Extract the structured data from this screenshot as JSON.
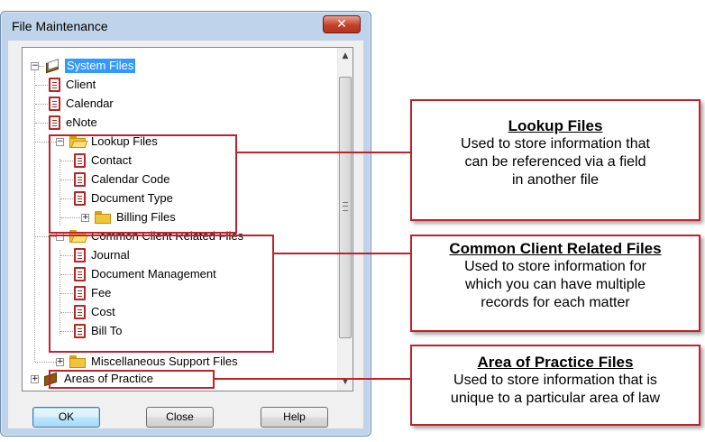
{
  "window": {
    "title": "File Maintenance",
    "close_glyph": "✕"
  },
  "tree": {
    "items": [
      {
        "label": "System Files",
        "icon": "book-icon",
        "selected": true
      },
      {
        "label": "Client",
        "icon": "document-icon"
      },
      {
        "label": "Calendar",
        "icon": "document-icon"
      },
      {
        "label": "eNote",
        "icon": "document-icon"
      },
      {
        "label": "Lookup Files",
        "icon": "open-folder-icon"
      },
      {
        "label": "Contact",
        "icon": "document-icon"
      },
      {
        "label": "Calendar Code",
        "icon": "document-icon"
      },
      {
        "label": "Document Type",
        "icon": "document-icon"
      },
      {
        "label": "Billing Files",
        "icon": "folder-icon"
      },
      {
        "label": "Common Client Related Files",
        "icon": "open-folder-icon"
      },
      {
        "label": "Journal",
        "icon": "document-icon"
      },
      {
        "label": "Document Management",
        "icon": "document-icon"
      },
      {
        "label": "Fee",
        "icon": "document-icon"
      },
      {
        "label": "Cost",
        "icon": "document-icon"
      },
      {
        "label": "Bill To",
        "icon": "document-icon"
      },
      {
        "label": "Miscellaneous Support Files",
        "icon": "folder-icon"
      },
      {
        "label": "Areas of Practice",
        "icon": "book-icon"
      }
    ],
    "expand_glyphs": {
      "collapse": "−",
      "expand": "+"
    }
  },
  "scrollbar": {
    "up_glyph": "▲",
    "down_glyph": "▼"
  },
  "buttons": {
    "ok": "OK",
    "close": "Close",
    "help": "Help"
  },
  "callouts": [
    {
      "title": "Lookup Files",
      "body": [
        "Used to store information that",
        "can be referenced via a field",
        "in another file"
      ]
    },
    {
      "title": "Common Client Related Files",
      "body": [
        "Used to store information for",
        "which you can have multiple",
        "records for each matter"
      ]
    },
    {
      "title": "Area of Practice Files",
      "body": [
        "Used to store information that is",
        "unique to a particular area of law"
      ]
    }
  ],
  "colors": {
    "highlight": "#c0222c",
    "selection": "#3399ff",
    "window_frame": "#bfd3ea"
  }
}
